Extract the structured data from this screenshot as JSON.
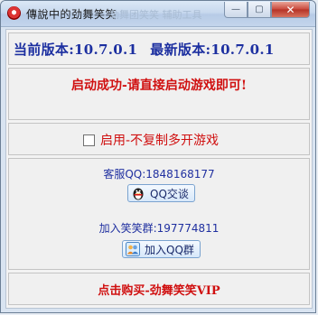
{
  "window": {
    "title": "傳說中的劲舞笑笑",
    "blurred_caption": "劲舞团笑笑 辅助工具"
  },
  "titlebar": {
    "minimize": "—",
    "maximize": "▢",
    "close": "✕"
  },
  "version": {
    "current": "当前版本:10.7.0.1",
    "latest": "最新版本:10.7.0.1"
  },
  "status": {
    "message": "启动成功-请直接启动游戏即可!"
  },
  "option": {
    "checkbox_label": "启用-不复制多开游戏",
    "checked": false
  },
  "contact": {
    "service_qq": "客服QQ:1848168177",
    "qq_chat_button": "QQ交谈",
    "group_text": "加入笑笑群:197774811",
    "join_group_button": "加入QQ群"
  },
  "vip": {
    "label": "点击购买-劲舞笑笑VIP"
  },
  "colors": {
    "title_text": "#1a1a1a",
    "version_text": "#1c2fa0",
    "status_text": "#d01010",
    "link_text": "#2030a0"
  }
}
